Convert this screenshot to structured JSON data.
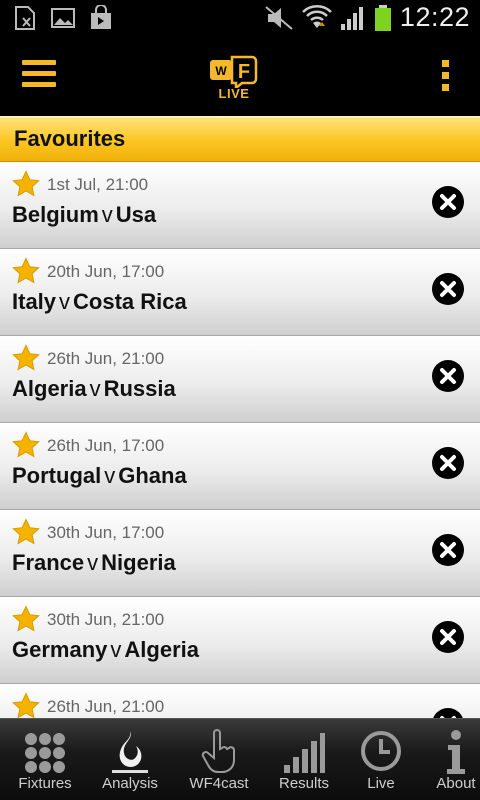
{
  "status_bar": {
    "time": "12:22"
  },
  "app_bar": {
    "logo_letters": "WF",
    "logo_sub": "LIVE"
  },
  "section": {
    "title": "Favourites"
  },
  "vs_label": "v",
  "favourites": [
    {
      "date": "1st Jul, 21:00",
      "home": "Belgium",
      "away": "Usa"
    },
    {
      "date": "20th Jun, 17:00",
      "home": "Italy",
      "away": "Costa Rica"
    },
    {
      "date": "26th Jun, 21:00",
      "home": "Algeria",
      "away": "Russia"
    },
    {
      "date": "26th Jun, 17:00",
      "home": "Portugal",
      "away": "Ghana"
    },
    {
      "date": "30th Jun, 17:00",
      "home": "France",
      "away": "Nigeria"
    },
    {
      "date": "30th Jun, 21:00",
      "home": "Germany",
      "away": "Algeria"
    },
    {
      "date": "26th Jun, 21:00",
      "home": "",
      "away": ""
    }
  ],
  "tabs": [
    {
      "label": "Fixtures",
      "icon": "grid-dots-icon"
    },
    {
      "label": "Analysis",
      "icon": "flame-icon"
    },
    {
      "label": "WF4cast",
      "icon": "hand-pointer-icon"
    },
    {
      "label": "Results",
      "icon": "signal-bars-icon"
    },
    {
      "label": "Live",
      "icon": "clock-icon"
    },
    {
      "label": "About",
      "icon": "info-icon"
    }
  ],
  "colors": {
    "accent": "#f5b82a",
    "header_gradient_top": "#ffe27a",
    "header_gradient_bottom": "#f0b00c",
    "star": "#f5b300"
  }
}
